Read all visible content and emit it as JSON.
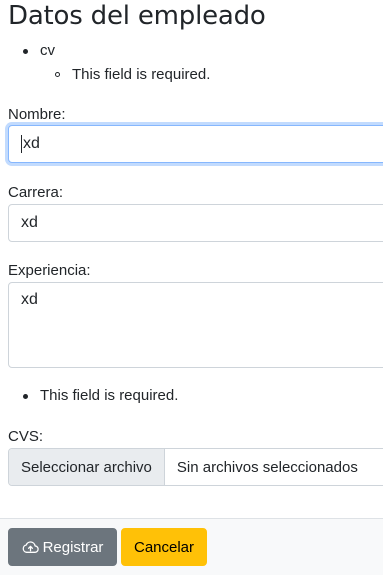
{
  "heading": "Datos del empleado",
  "errors_top": {
    "field": "cv",
    "message": "This field is required."
  },
  "form": {
    "nombre": {
      "label": "Nombre:",
      "value": "xd"
    },
    "carrera": {
      "label": "Carrera:",
      "value": "xd"
    },
    "experiencia": {
      "label": "Experiencia:",
      "value": "xd"
    },
    "cvs_error": "This field is required.",
    "cvs": {
      "label": "CVS:",
      "button_label": "Seleccionar archivo",
      "status": "Sin archivos seleccionados"
    }
  },
  "footer": {
    "register_label": "Registrar",
    "register_icon": "cloud-upload-icon",
    "cancel_label": "Cancelar"
  },
  "colors": {
    "secondary": "#6c757d",
    "warning": "#ffc107",
    "focus": "#86b7fe",
    "footer_bg": "#f8f9fa"
  }
}
